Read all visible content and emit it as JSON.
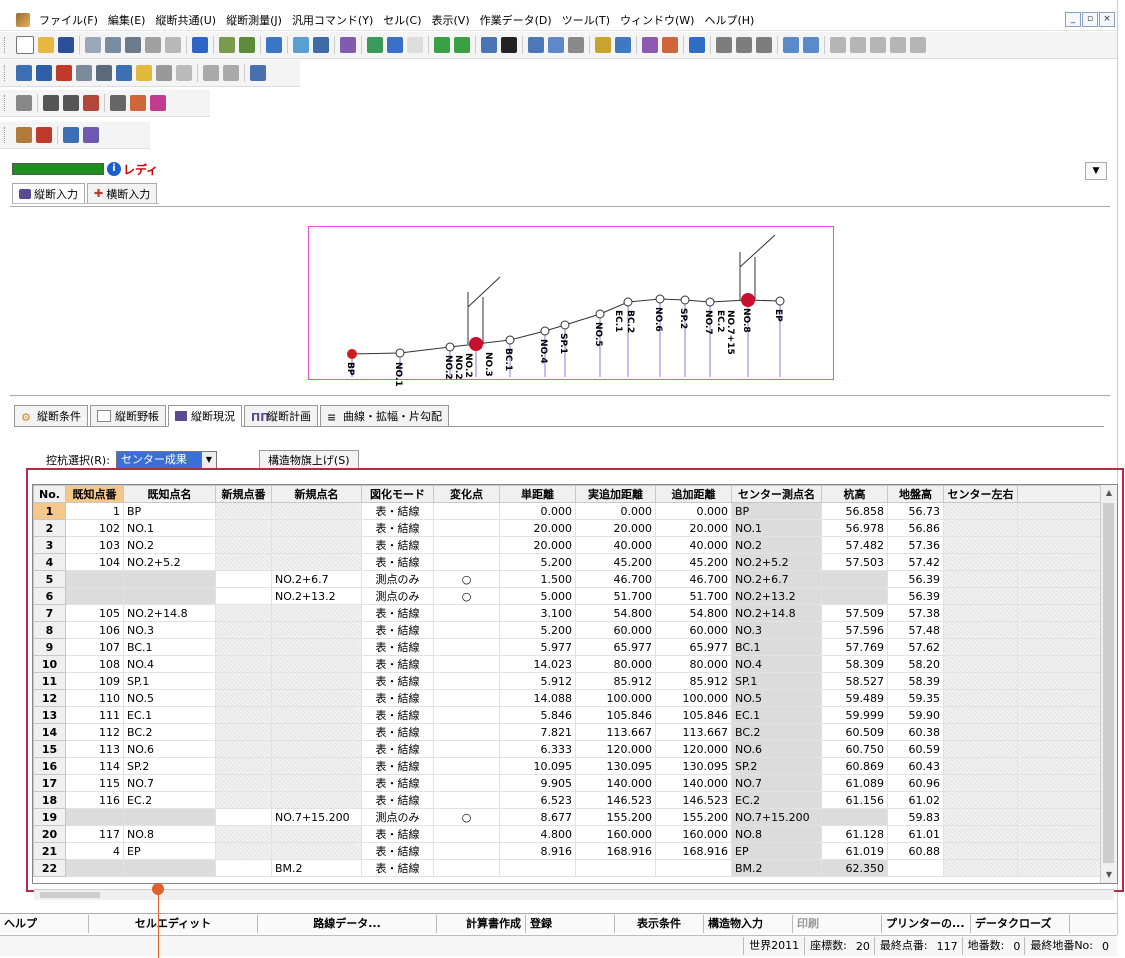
{
  "menu": [
    "ファイル(F)",
    "編集(E)",
    "縦断共通(U)",
    "縦断測量(J)",
    "汎用コマンド(Y)",
    "セル(C)",
    "表示(V)",
    "作業データ(D)",
    "ツール(T)",
    "ウィンドウ(W)",
    "ヘルプ(H)"
  ],
  "window_buttons": [
    "_",
    "▫",
    "×"
  ],
  "status": {
    "text": "レディ"
  },
  "view_tabs": [
    "縦断入力",
    "横断入力"
  ],
  "lower_tabs": [
    "縦断条件",
    "縦断野帳",
    "縦断現況",
    "縦断計画",
    "曲線・拡幅・片勾配"
  ],
  "control": {
    "label": "控杭選択(R):",
    "combo_value": "センター成果",
    "button": "構造物旗上げ(S)"
  },
  "table": {
    "headers": [
      "No.",
      "既知点番",
      "既知点名",
      "新規点番",
      "新規点名",
      "図化モード",
      "変化点",
      "単距離",
      "実追加距離",
      "追加距離",
      "センター測点名",
      "杭高",
      "地盤高",
      "センター左右"
    ],
    "rows": [
      [
        "1",
        "1",
        "BP",
        "",
        "",
        "表・結線",
        "",
        "0.000",
        "0.000",
        "0.000",
        "BP",
        "56.858",
        "56.73",
        ""
      ],
      [
        "2",
        "102",
        "NO.1",
        "",
        "",
        "表・結線",
        "",
        "20.000",
        "20.000",
        "20.000",
        "NO.1",
        "56.978",
        "56.86",
        ""
      ],
      [
        "3",
        "103",
        "NO.2",
        "",
        "",
        "表・結線",
        "",
        "20.000",
        "40.000",
        "40.000",
        "NO.2",
        "57.482",
        "57.36",
        ""
      ],
      [
        "4",
        "104",
        "NO.2+5.2",
        "",
        "",
        "表・結線",
        "",
        "5.200",
        "45.200",
        "45.200",
        "NO.2+5.2",
        "57.503",
        "57.42",
        ""
      ],
      [
        "5",
        "",
        "",
        "",
        "NO.2+6.7",
        "測点のみ",
        "○",
        "1.500",
        "46.700",
        "46.700",
        "NO.2+6.7",
        "",
        "56.39",
        ""
      ],
      [
        "6",
        "",
        "",
        "",
        "NO.2+13.2",
        "測点のみ",
        "○",
        "5.000",
        "51.700",
        "51.700",
        "NO.2+13.2",
        "",
        "56.39",
        ""
      ],
      [
        "7",
        "105",
        "NO.2+14.8",
        "",
        "",
        "表・結線",
        "",
        "3.100",
        "54.800",
        "54.800",
        "NO.2+14.8",
        "57.509",
        "57.38",
        ""
      ],
      [
        "8",
        "106",
        "NO.3",
        "",
        "",
        "表・結線",
        "",
        "5.200",
        "60.000",
        "60.000",
        "NO.3",
        "57.596",
        "57.48",
        ""
      ],
      [
        "9",
        "107",
        "BC.1",
        "",
        "",
        "表・結線",
        "",
        "5.977",
        "65.977",
        "65.977",
        "BC.1",
        "57.769",
        "57.62",
        ""
      ],
      [
        "10",
        "108",
        "NO.4",
        "",
        "",
        "表・結線",
        "",
        "14.023",
        "80.000",
        "80.000",
        "NO.4",
        "58.309",
        "58.20",
        ""
      ],
      [
        "11",
        "109",
        "SP.1",
        "",
        "",
        "表・結線",
        "",
        "5.912",
        "85.912",
        "85.912",
        "SP.1",
        "58.527",
        "58.39",
        ""
      ],
      [
        "12",
        "110",
        "NO.5",
        "",
        "",
        "表・結線",
        "",
        "14.088",
        "100.000",
        "100.000",
        "NO.5",
        "59.489",
        "59.35",
        ""
      ],
      [
        "13",
        "111",
        "EC.1",
        "",
        "",
        "表・結線",
        "",
        "5.846",
        "105.846",
        "105.846",
        "EC.1",
        "59.999",
        "59.90",
        ""
      ],
      [
        "14",
        "112",
        "BC.2",
        "",
        "",
        "表・結線",
        "",
        "7.821",
        "113.667",
        "113.667",
        "BC.2",
        "60.509",
        "60.38",
        ""
      ],
      [
        "15",
        "113",
        "NO.6",
        "",
        "",
        "表・結線",
        "",
        "6.333",
        "120.000",
        "120.000",
        "NO.6",
        "60.750",
        "60.59",
        ""
      ],
      [
        "16",
        "114",
        "SP.2",
        "",
        "",
        "表・結線",
        "",
        "10.095",
        "130.095",
        "130.095",
        "SP.2",
        "60.869",
        "60.43",
        ""
      ],
      [
        "17",
        "115",
        "NO.7",
        "",
        "",
        "表・結線",
        "",
        "9.905",
        "140.000",
        "140.000",
        "NO.7",
        "61.089",
        "60.96",
        ""
      ],
      [
        "18",
        "116",
        "EC.2",
        "",
        "",
        "表・結線",
        "",
        "6.523",
        "146.523",
        "146.523",
        "EC.2",
        "61.156",
        "61.02",
        ""
      ],
      [
        "19",
        "",
        "",
        "",
        "NO.7+15.200",
        "測点のみ",
        "○",
        "8.677",
        "155.200",
        "155.200",
        "NO.7+15.200",
        "",
        "59.83",
        ""
      ],
      [
        "20",
        "117",
        "NO.8",
        "",
        "",
        "表・結線",
        "",
        "4.800",
        "160.000",
        "160.000",
        "NO.8",
        "61.128",
        "61.01",
        ""
      ],
      [
        "21",
        "4",
        "EP",
        "",
        "",
        "表・結線",
        "",
        "8.916",
        "168.916",
        "168.916",
        "EP",
        "61.019",
        "60.88",
        ""
      ],
      [
        "22",
        "",
        "",
        "",
        "BM.2",
        "表・結線",
        "",
        "",
        "",
        "",
        "BM.2",
        "62.350",
        "",
        ""
      ]
    ]
  },
  "profile_labels": [
    "BP",
    "NO.1",
    "NO.2",
    "NO.2",
    "NO.2",
    "NO.3",
    "BC.1",
    "NO.4",
    "SP.1",
    "NO.5",
    "EC.1",
    "BC.2",
    "NO.6",
    "SP.2",
    "NO.7",
    "EC.2",
    "NO.7+15",
    "NO.8",
    "EP"
  ],
  "func_keys": [
    "ヘルプ",
    "セルエディット",
    "路線データ...",
    "計算書作成",
    "登録",
    "表示条件",
    "構造物入力",
    "印刷",
    "プリンターの...",
    "データクローズ"
  ],
  "statusbar": [
    "世界2011",
    "座標数:",
    "20",
    "最終点番:",
    "117",
    "地番数:",
    "0",
    "最終地番No:",
    "0"
  ]
}
